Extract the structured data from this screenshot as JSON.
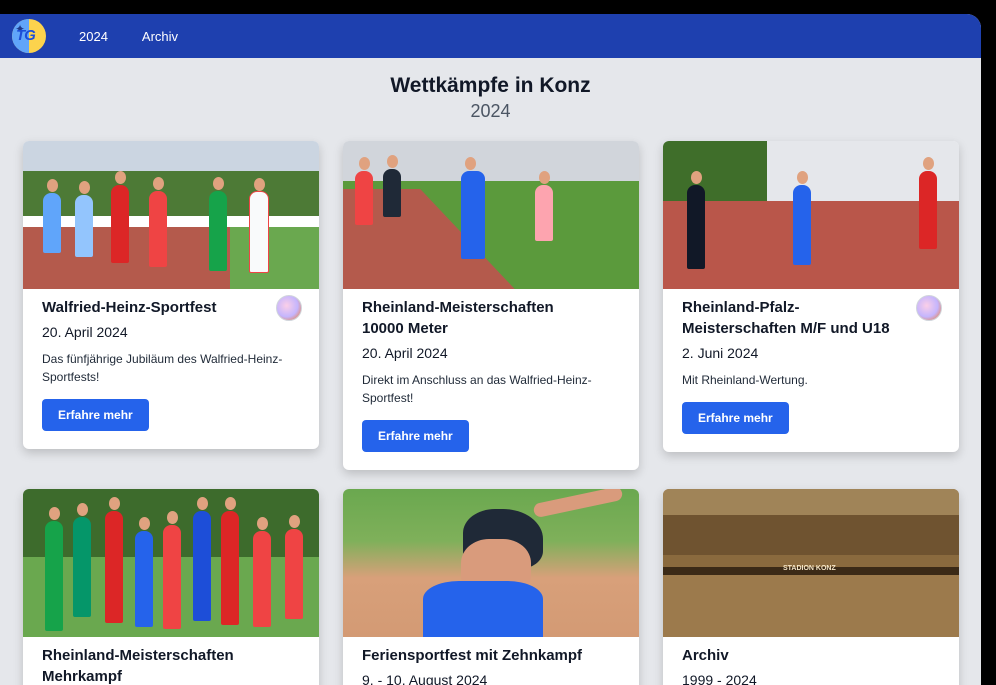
{
  "nav": {
    "logo_text": "TG",
    "links": [
      "2024",
      "Archiv"
    ]
  },
  "page": {
    "title": "Wettkämpfe in Konz",
    "subtitle": "2024"
  },
  "cards": [
    {
      "title": "Walfried-Heinz-Sportfest",
      "date": "20. April 2024",
      "desc": "Das fünfjährige Jubiläum des Walfried-Heinz-Sportfests!",
      "button": "Erfahre mehr",
      "badge": true
    },
    {
      "title": "Rheinland-Meisterschaften 10000 Meter",
      "date": "20. April 2024",
      "desc": "Direkt im Anschluss an das Walfried-Heinz-Sportfest!",
      "button": "Erfahre mehr",
      "badge": false
    },
    {
      "title": "Rheinland-Pfalz-Meisterschaften M/F und U18",
      "date": "2. Juni 2024",
      "desc": "Mit Rheinland-Wertung.",
      "button": "Erfahre mehr",
      "badge": true
    },
    {
      "title": "Rheinland-Meisterschaften Mehrkampf",
      "date": "",
      "desc": "",
      "button": "",
      "badge": false
    },
    {
      "title": "Feriensportfest mit Zehnkampf",
      "date": "9. - 10. August 2024",
      "desc": "",
      "button": "",
      "badge": false
    },
    {
      "title": "Archiv",
      "date": "1999 - 2024",
      "desc": "",
      "button": "",
      "badge": false
    }
  ],
  "photo_labels": {
    "stadium_sign": "STADION KONZ"
  },
  "colors": {
    "navbar": "#1e40af",
    "button": "#2563eb",
    "background": "#e5e7eb"
  }
}
